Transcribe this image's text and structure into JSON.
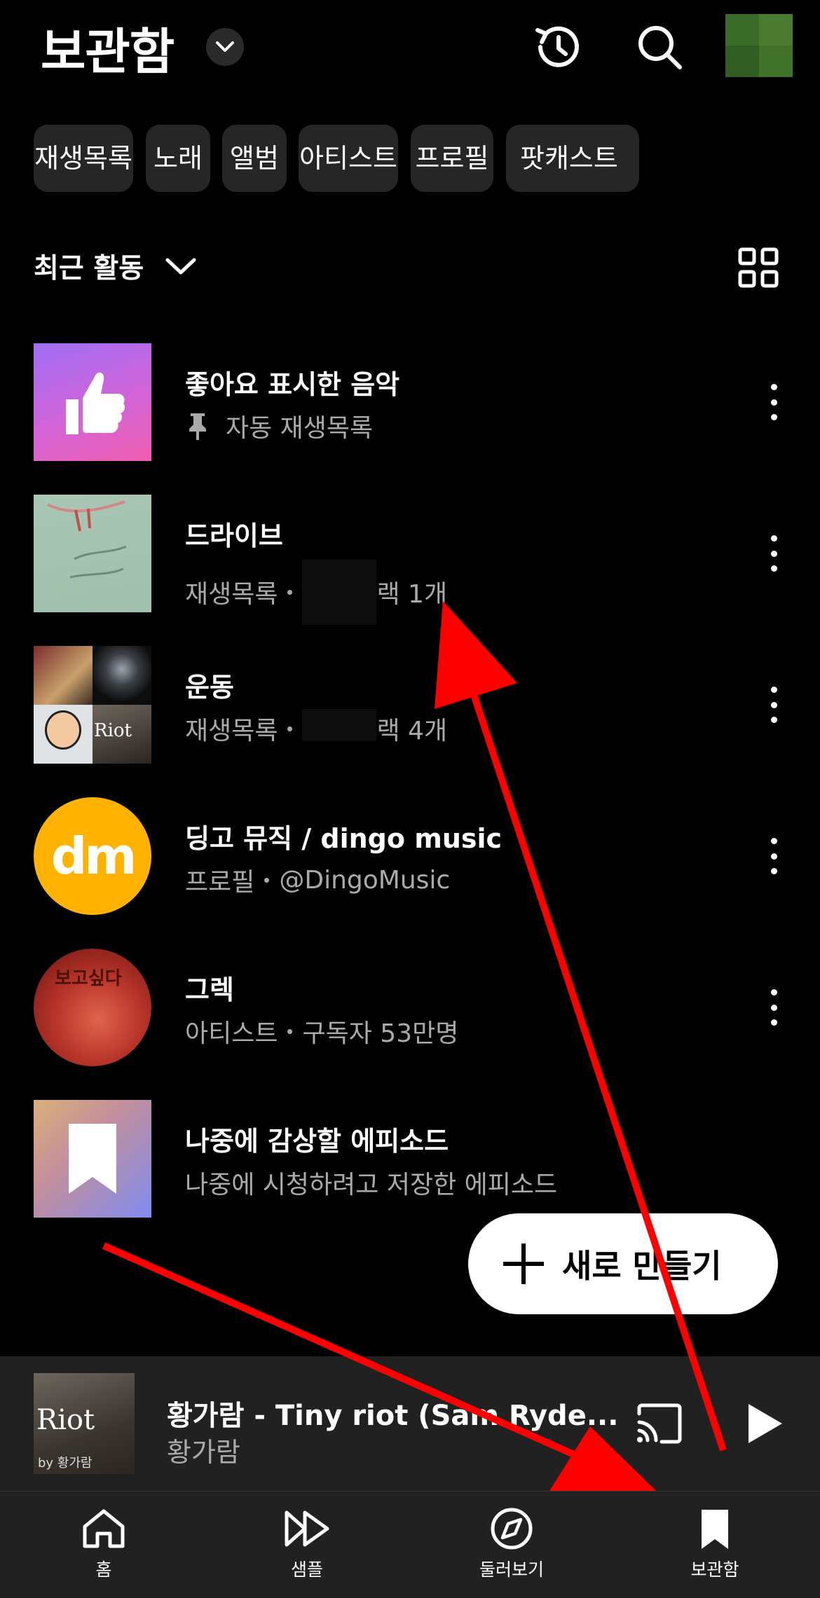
{
  "header": {
    "title": "보관함"
  },
  "chips": [
    "재생목록",
    "노래",
    "앨범",
    "아티스트",
    "프로필",
    "팟캐스트"
  ],
  "sort": {
    "label": "최근 활동"
  },
  "items": [
    {
      "title": "좋아요 표시한 음악",
      "subtitle": "자동 재생목록"
    },
    {
      "title": "드라이브",
      "type": "재생목록",
      "meta": "랙 1개"
    },
    {
      "title": "운동",
      "type": "재생목록",
      "meta": "랙 4개"
    },
    {
      "title": "딩고 뮤직 / dingo music",
      "type": "프로필",
      "meta": "@DingoMusic",
      "logo_text": "dm"
    },
    {
      "title": "그렉",
      "type": "아티스트",
      "meta": "구독자 53만명",
      "art_text": "보고싶다"
    },
    {
      "title": "나중에 감상할 에피소드",
      "subtitle": "나중에 시청하려고 저장한 에피소드"
    }
  ],
  "thumb_text": {
    "riot": "Riot"
  },
  "fab": {
    "label": "새로 만들기"
  },
  "player": {
    "title": "황가람 - Tiny riot (Sam Ryde...",
    "artist": "황가람",
    "art_title": "Riot",
    "art_by": "by 황가람"
  },
  "nav": [
    {
      "label": "홈",
      "icon": "home-icon"
    },
    {
      "label": "샘플",
      "icon": "samples-icon"
    },
    {
      "label": "둘러보기",
      "icon": "explore-icon"
    },
    {
      "label": "보관함",
      "icon": "library-icon"
    }
  ],
  "colors": {
    "background": "#000000",
    "chip": "#262626",
    "player": "#212121",
    "annotation": "#ff0000"
  }
}
